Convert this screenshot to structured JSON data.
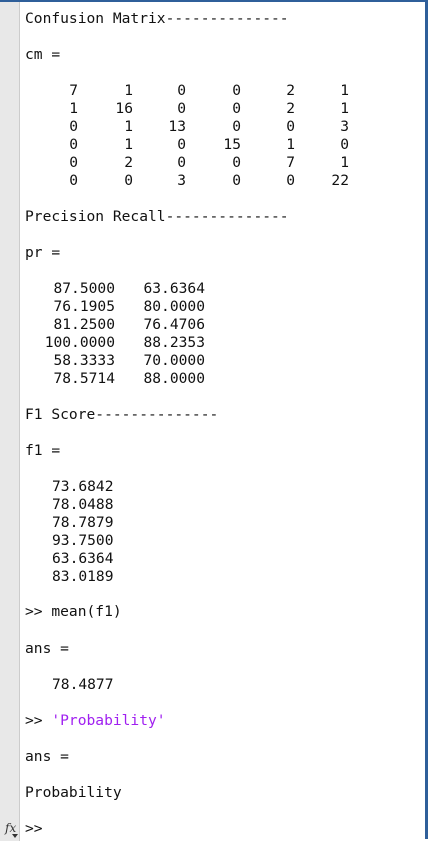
{
  "cm_header": "Confusion Matrix--------------",
  "cm_assign": "cm =",
  "cm_rows": [
    [
      "7",
      "1",
      "0",
      "0",
      "2",
      "1"
    ],
    [
      "1",
      "16",
      "0",
      "0",
      "2",
      "1"
    ],
    [
      "0",
      "1",
      "13",
      "0",
      "0",
      "3"
    ],
    [
      "0",
      "1",
      "0",
      "15",
      "1",
      "0"
    ],
    [
      "0",
      "2",
      "0",
      "0",
      "7",
      "1"
    ],
    [
      "0",
      "0",
      "3",
      "0",
      "0",
      "22"
    ]
  ],
  "pr_header": "Precision Recall--------------",
  "pr_assign": "pr =",
  "pr_rows": [
    [
      "87.5000",
      "63.6364"
    ],
    [
      "76.1905",
      "80.0000"
    ],
    [
      "81.2500",
      "76.4706"
    ],
    [
      "100.0000",
      "88.2353"
    ],
    [
      "58.3333",
      "70.0000"
    ],
    [
      "78.5714",
      "88.0000"
    ]
  ],
  "f1_header": "F1 Score--------------",
  "f1_assign": "f1 =",
  "f1_values": [
    "73.6842",
    "78.0488",
    "78.7879",
    "93.7500",
    "63.6364",
    "83.0189"
  ],
  "mean_prompt": ">> ",
  "mean_command": "mean(f1)",
  "ans1_assign": "ans =",
  "ans1_value": "78.4877",
  "str_prompt": ">> ",
  "str_command": "'Probability'",
  "ans2_assign": "ans =",
  "ans2_value": "Probability",
  "input_prompt": ">>",
  "fx_label": "fx",
  "colors": {
    "string": "#a020f0",
    "frame": "#2f5f9a",
    "gutter": "#e8e8e8"
  }
}
